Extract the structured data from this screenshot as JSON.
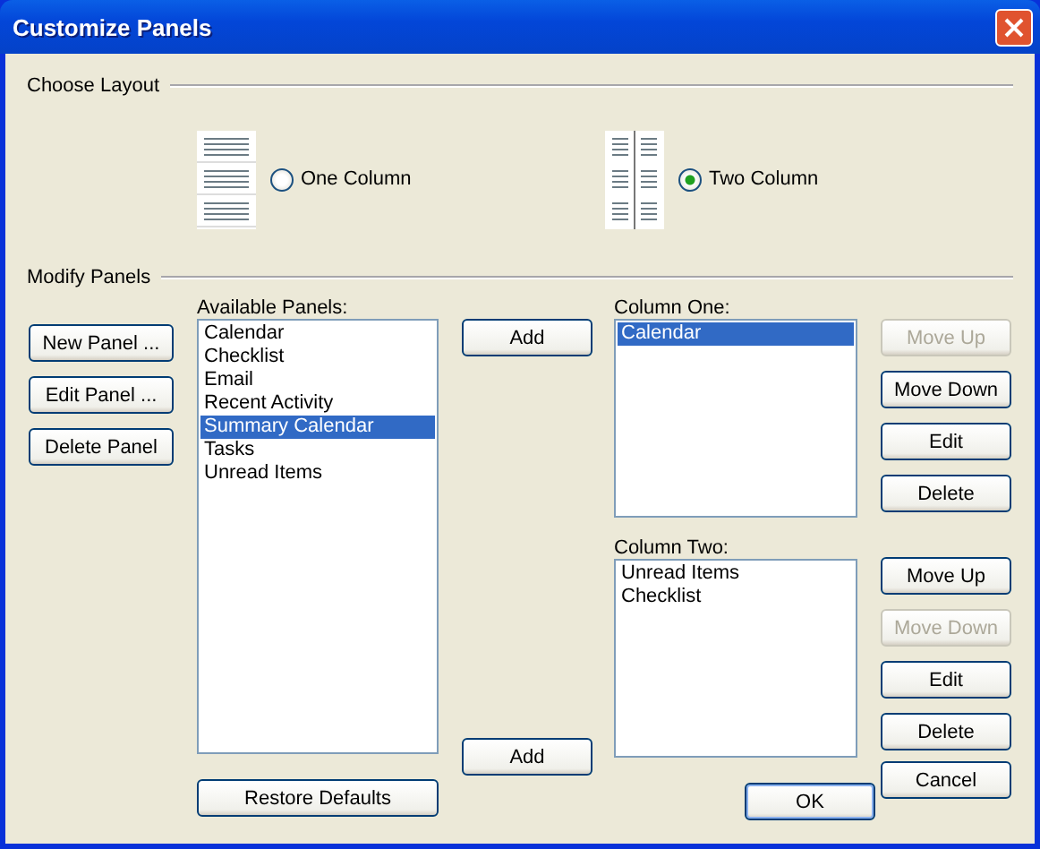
{
  "window": {
    "title": "Customize Panels"
  },
  "choose_layout": {
    "label": "Choose Layout",
    "options": [
      {
        "kind": "one",
        "label": "One Column",
        "selected": false
      },
      {
        "kind": "two",
        "label": "Two Column",
        "selected": true
      }
    ]
  },
  "modify_panels": {
    "label": "Modify Panels",
    "panel_buttons": [
      {
        "label": "New Panel ..."
      },
      {
        "label": "Edit Panel ..."
      },
      {
        "label": "Delete Panel"
      }
    ],
    "available": {
      "label": "Available Panels:",
      "items": [
        {
          "label": "Calendar",
          "selected": false
        },
        {
          "label": "Checklist",
          "selected": false
        },
        {
          "label": "Email",
          "selected": false
        },
        {
          "label": "Recent Activity",
          "selected": false
        },
        {
          "label": "Summary Calendar",
          "selected": true
        },
        {
          "label": "Tasks",
          "selected": false
        },
        {
          "label": "Unread Items",
          "selected": false
        }
      ]
    },
    "add_buttons": [
      {
        "label": "Add"
      },
      {
        "label": "Add"
      }
    ],
    "columns": [
      {
        "label": "Column One:",
        "items": [
          {
            "label": "Calendar",
            "selected": true
          }
        ],
        "buttons": [
          {
            "label": "Move Up",
            "disabled": true
          },
          {
            "label": "Move Down",
            "disabled": false
          },
          {
            "label": "Edit",
            "disabled": false
          },
          {
            "label": "Delete",
            "disabled": false
          }
        ]
      },
      {
        "label": "Column Two:",
        "items": [
          {
            "label": "Unread Items",
            "selected": false
          },
          {
            "label": "Checklist",
            "selected": false
          }
        ],
        "buttons": [
          {
            "label": "Move Up",
            "disabled": false
          },
          {
            "label": "Move Down",
            "disabled": true
          },
          {
            "label": "Edit",
            "disabled": false
          },
          {
            "label": "Delete",
            "disabled": false
          }
        ]
      }
    ],
    "restore_button": "Restore Defaults"
  },
  "footer": {
    "ok": "OK",
    "cancel": "Cancel"
  }
}
